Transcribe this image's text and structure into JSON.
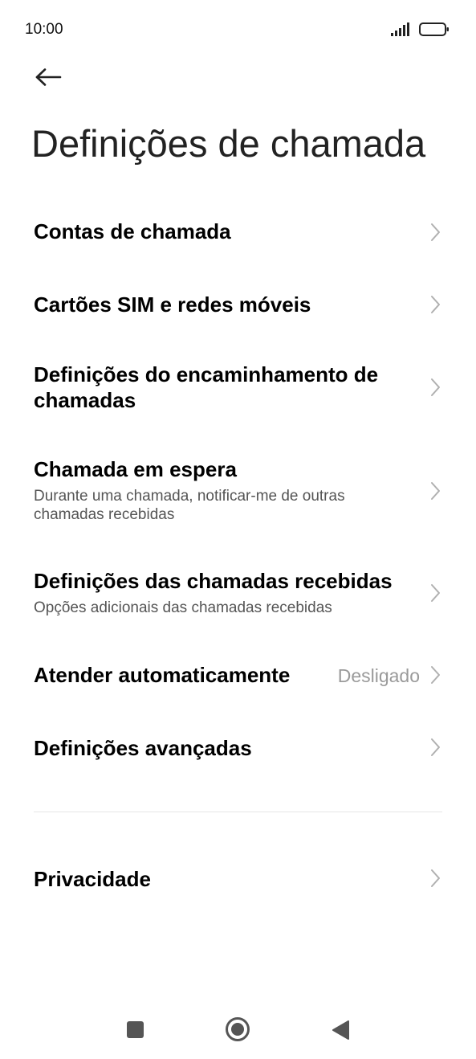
{
  "status_bar": {
    "time": "10:00"
  },
  "page": {
    "title": "Definições de chamada"
  },
  "settings": {
    "call_accounts": {
      "title": "Contas de chamada"
    },
    "sim_networks": {
      "title": "Cartões SIM e redes móveis"
    },
    "call_forwarding": {
      "title": "Definições do encaminhamento de chamadas"
    },
    "call_waiting": {
      "title": "Chamada em espera",
      "subtitle": "Durante uma chamada, notificar-me de outras chamadas recebidas"
    },
    "incoming_calls": {
      "title": "Definições das chamadas recebidas",
      "subtitle": "Opções adicionais das chamadas recebidas"
    },
    "auto_answer": {
      "title": "Atender automaticamente",
      "value": "Desligado"
    },
    "advanced": {
      "title": "Definições avançadas"
    },
    "privacy": {
      "title": "Privacidade"
    }
  },
  "icons": {
    "back": "arrow-left-icon",
    "chevron": "chevron-right-icon",
    "signal": "signal-icon",
    "battery": "battery-icon",
    "nav_recents": "square-icon",
    "nav_home": "circle-icon",
    "nav_back": "triangle-left-icon"
  },
  "colors": {
    "background": "#ffffff",
    "title_text": "#000000",
    "subtitle_text": "#555555",
    "value_text": "#9a9a9a",
    "chevron": "#b0b0b0"
  }
}
